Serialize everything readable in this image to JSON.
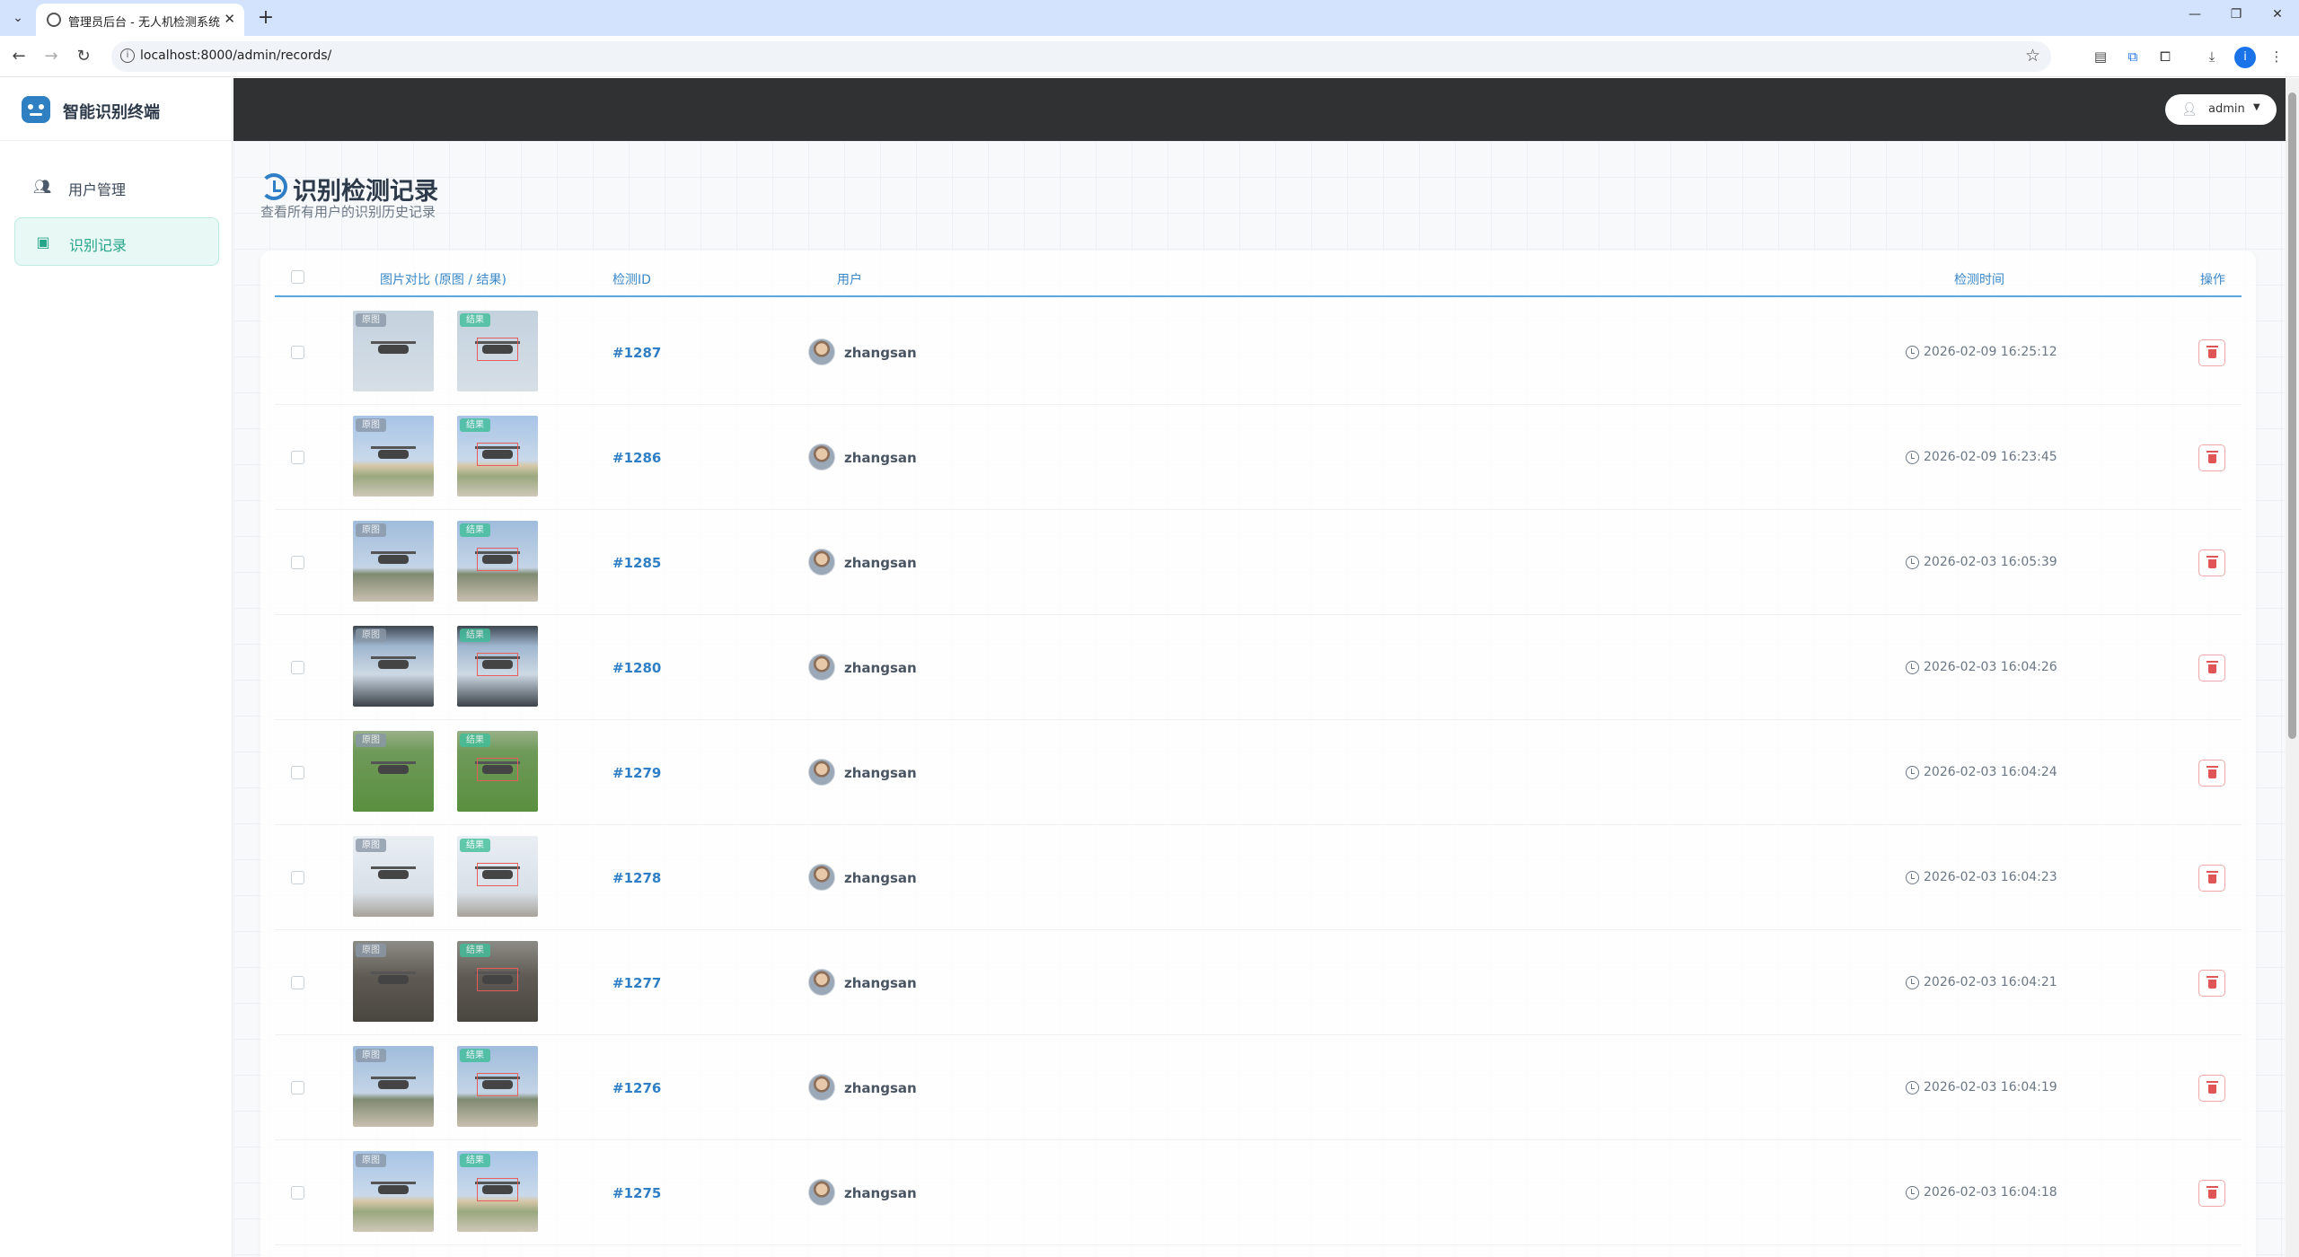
{
  "browser": {
    "tab_title": "管理员后台 - 无人机检测系统",
    "url": "localhost:8000/admin/records/",
    "profile_initial": "i"
  },
  "sidebar": {
    "brand": "智能识别终端",
    "items": [
      {
        "label": "用户管理",
        "icon": "users-icon",
        "active": false
      },
      {
        "label": "识别记录",
        "icon": "clipboard-check-icon",
        "active": true
      }
    ]
  },
  "header": {
    "user": "admin"
  },
  "page": {
    "title": "识别检测记录",
    "subtitle": "查看所有用户的识别历史记录"
  },
  "table": {
    "columns": [
      "图片对比 (原图 / 结果)",
      "检测ID",
      "用户",
      "检测时间",
      "操作"
    ],
    "original_badge": "原图",
    "result_badge": "结果",
    "rows": [
      {
        "id": "#1287",
        "user": "zhangsan",
        "time": "2026-02-09 16:25:12",
        "bg": "bg-haze"
      },
      {
        "id": "#1286",
        "user": "zhangsan",
        "time": "2026-02-09 16:23:45",
        "bg": "bg-sky"
      },
      {
        "id": "#1285",
        "user": "zhangsan",
        "time": "2026-02-03 16:05:39",
        "bg": "bg-sky2"
      },
      {
        "id": "#1280",
        "user": "zhangsan",
        "time": "2026-02-03 16:04:26",
        "bg": "bg-dark"
      },
      {
        "id": "#1279",
        "user": "zhangsan",
        "time": "2026-02-03 16:04:24",
        "bg": "bg-grass"
      },
      {
        "id": "#1278",
        "user": "zhangsan",
        "time": "2026-02-03 16:04:23",
        "bg": "bg-bright"
      },
      {
        "id": "#1277",
        "user": "zhangsan",
        "time": "2026-02-03 16:04:21",
        "bg": "bg-brown"
      },
      {
        "id": "#1276",
        "user": "zhangsan",
        "time": "2026-02-03 16:04:19",
        "bg": "bg-sky2"
      },
      {
        "id": "#1275",
        "user": "zhangsan",
        "time": "2026-02-03 16:04:18",
        "bg": "bg-sky"
      }
    ]
  },
  "colors": {
    "accent": "#2f7fc6",
    "active_menu": "#27a58b",
    "danger": "#e05555",
    "topbar": "#2f3133"
  }
}
